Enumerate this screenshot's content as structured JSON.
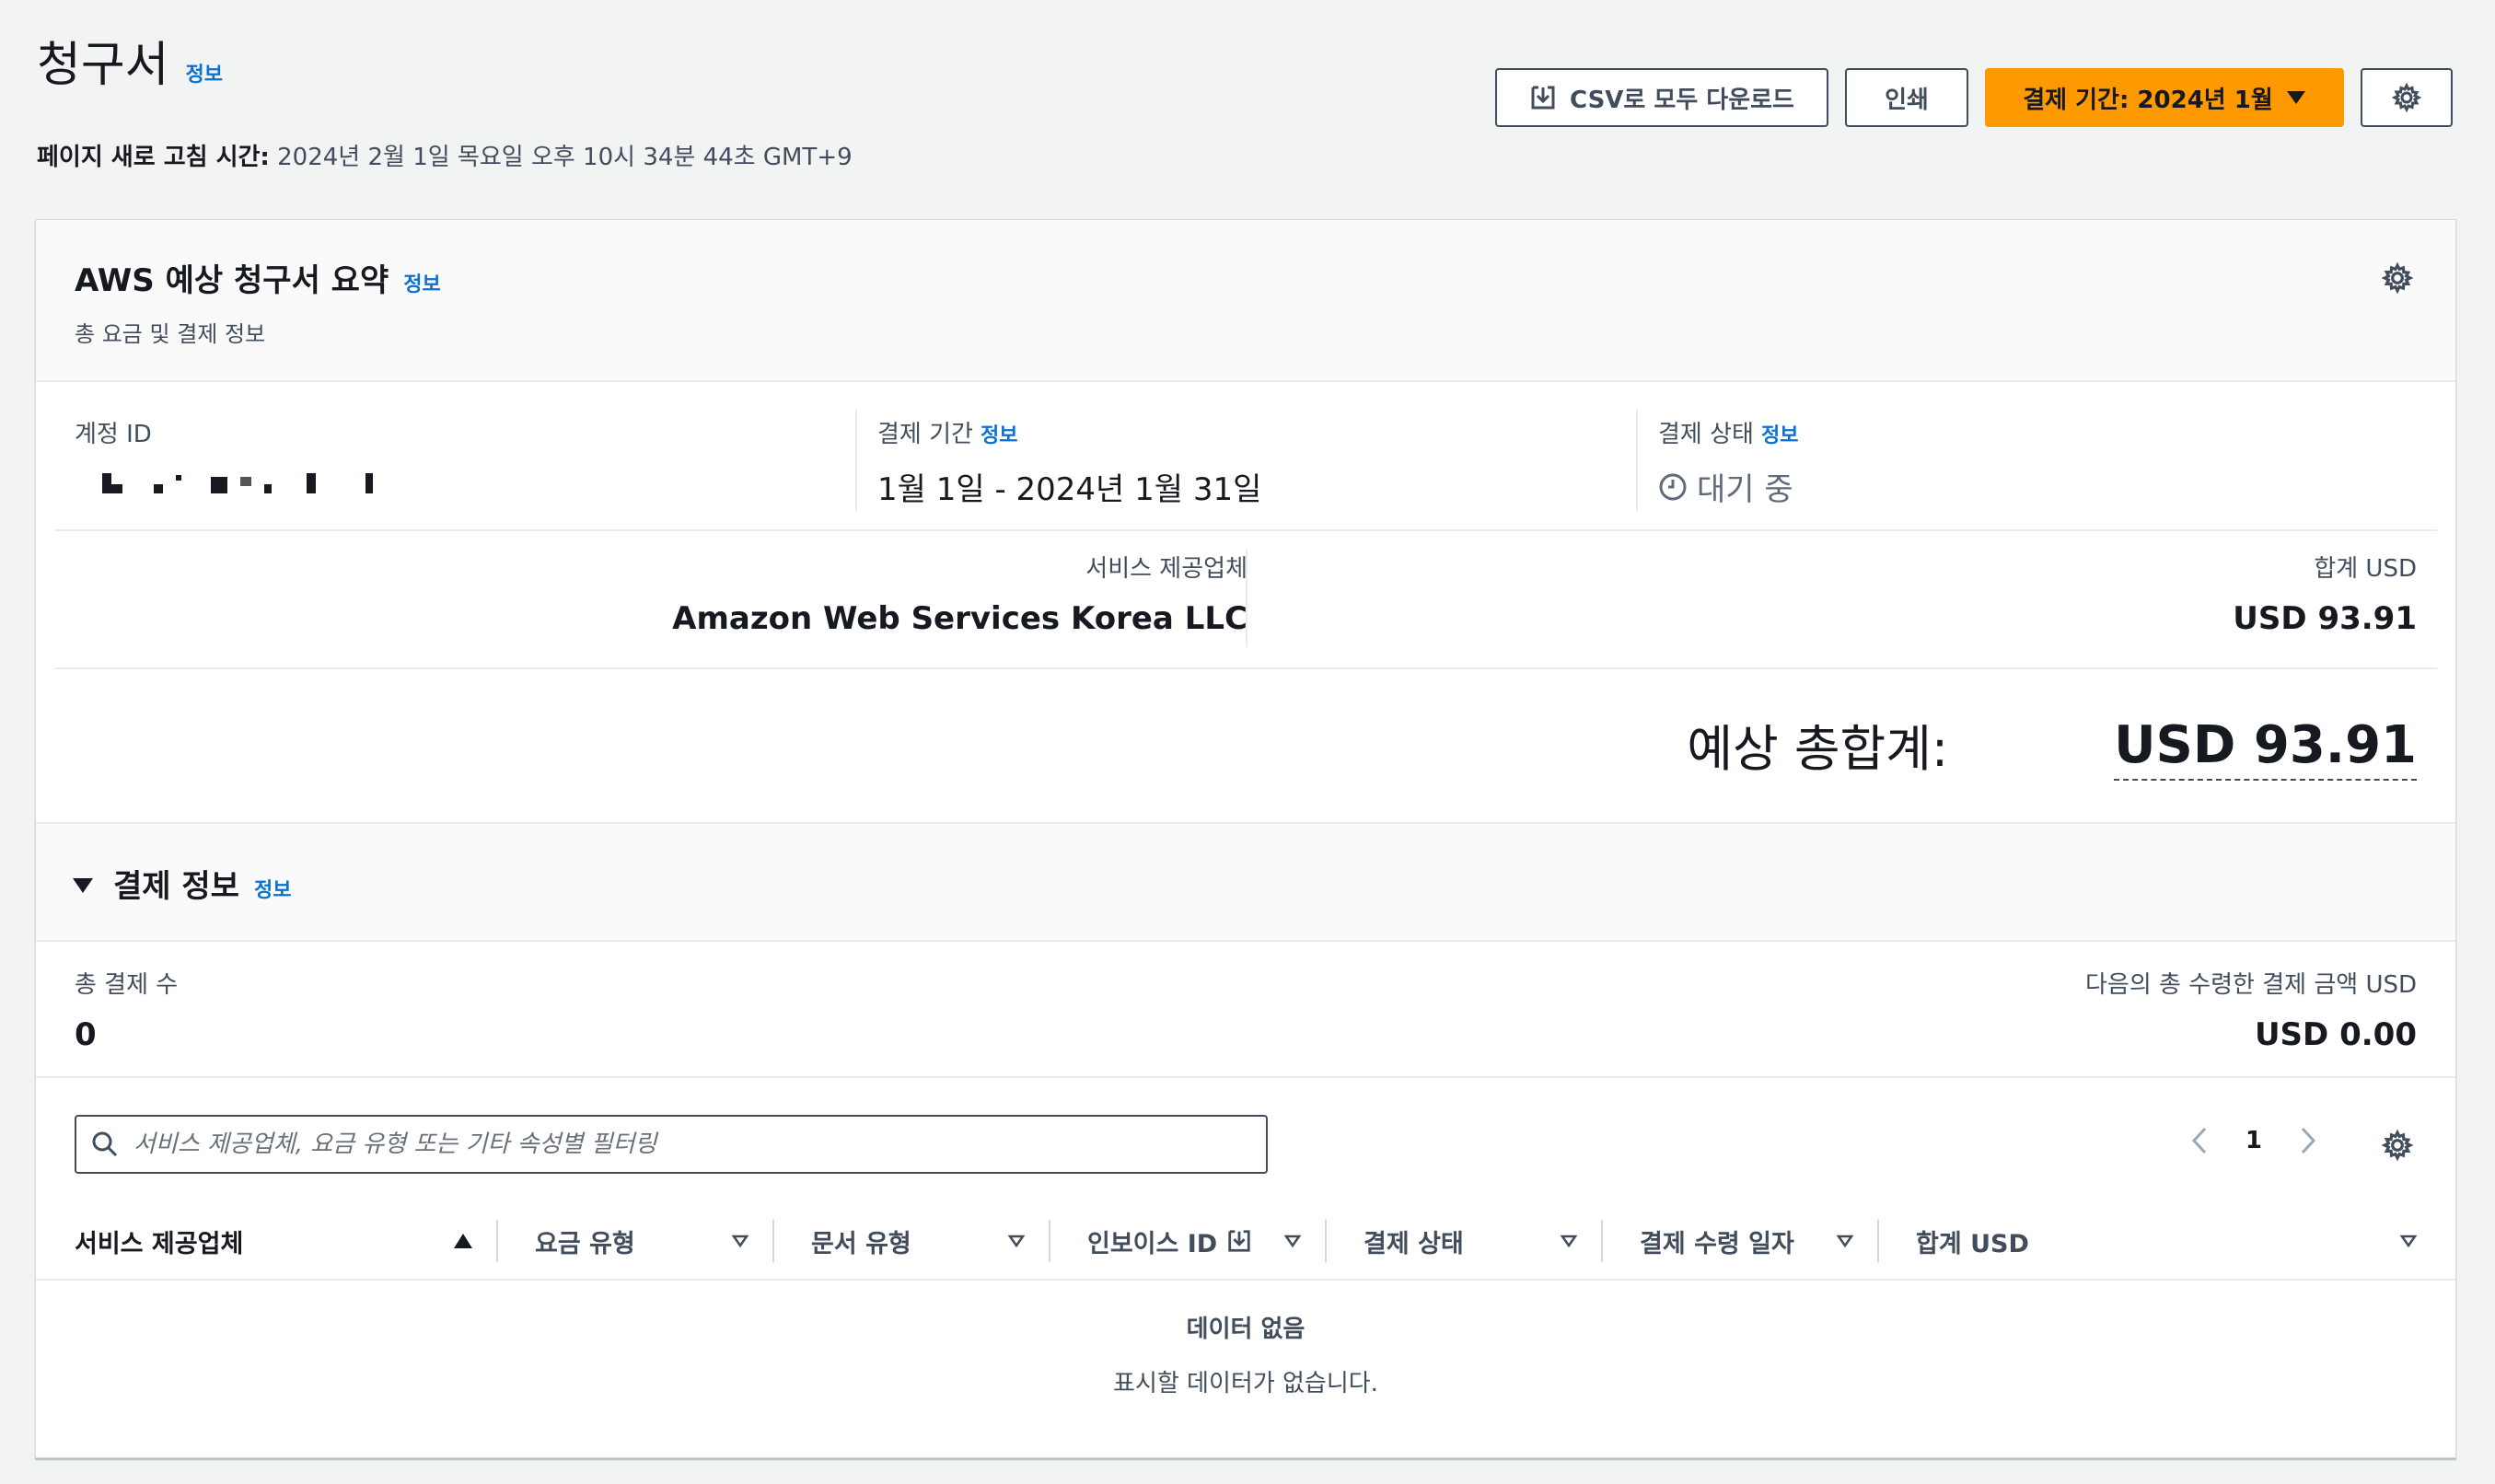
{
  "page": {
    "title": "청구서",
    "info": "정보",
    "refresh_label": "페이지 새로 고침 시간:",
    "refresh_value": "2024년 2월 1일 목요일 오후 10시 34분 44초 GMT+9"
  },
  "actions": {
    "csv_download": "CSV로 모두 다운로드",
    "print": "인쇄",
    "billing_period": "결제 기간: 2024년 1월"
  },
  "summary": {
    "title": "AWS 예상 청구서 요약",
    "info": "정보",
    "subtitle": "총 요금 및 결제 정보",
    "account_label": "계정 ID",
    "period_label": "결제 기간",
    "period_info": "정보",
    "period_value": "1월 1일 - 2024년 1월 31일",
    "status_label": "결제 상태",
    "status_info": "정보",
    "status_value": "대기 중",
    "provider_label": "서비스 제공업체",
    "provider_value": "Amazon Web Services Korea LLC",
    "total_label": "합계 USD",
    "total_value": "USD 93.91",
    "grand_label": "예상 총합계:",
    "grand_value": "USD 93.91"
  },
  "payments": {
    "title": "결제 정보",
    "info": "정보",
    "count_label": "총 결제 수",
    "count_value": "0",
    "sum_label": "다음의 총 수령한 결제 금액 USD",
    "sum_value": "USD 0.00"
  },
  "table": {
    "filter_placeholder": "서비스 제공업체, 요금 유형 또는 기타 속성별 필터링",
    "page": "1",
    "columns": [
      "서비스 제공업체",
      "요금 유형",
      "문서 유형",
      "인보이스 ID",
      "결제 상태",
      "결제 수령 일자",
      "합계 USD"
    ],
    "empty_title": "데이터 없음",
    "empty_sub": "표시할 데이터가 없습니다."
  },
  "colors": {
    "primary": "#ff9900",
    "link": "#0972d3",
    "text": "#16191f",
    "secondary_text": "#414d5c"
  }
}
